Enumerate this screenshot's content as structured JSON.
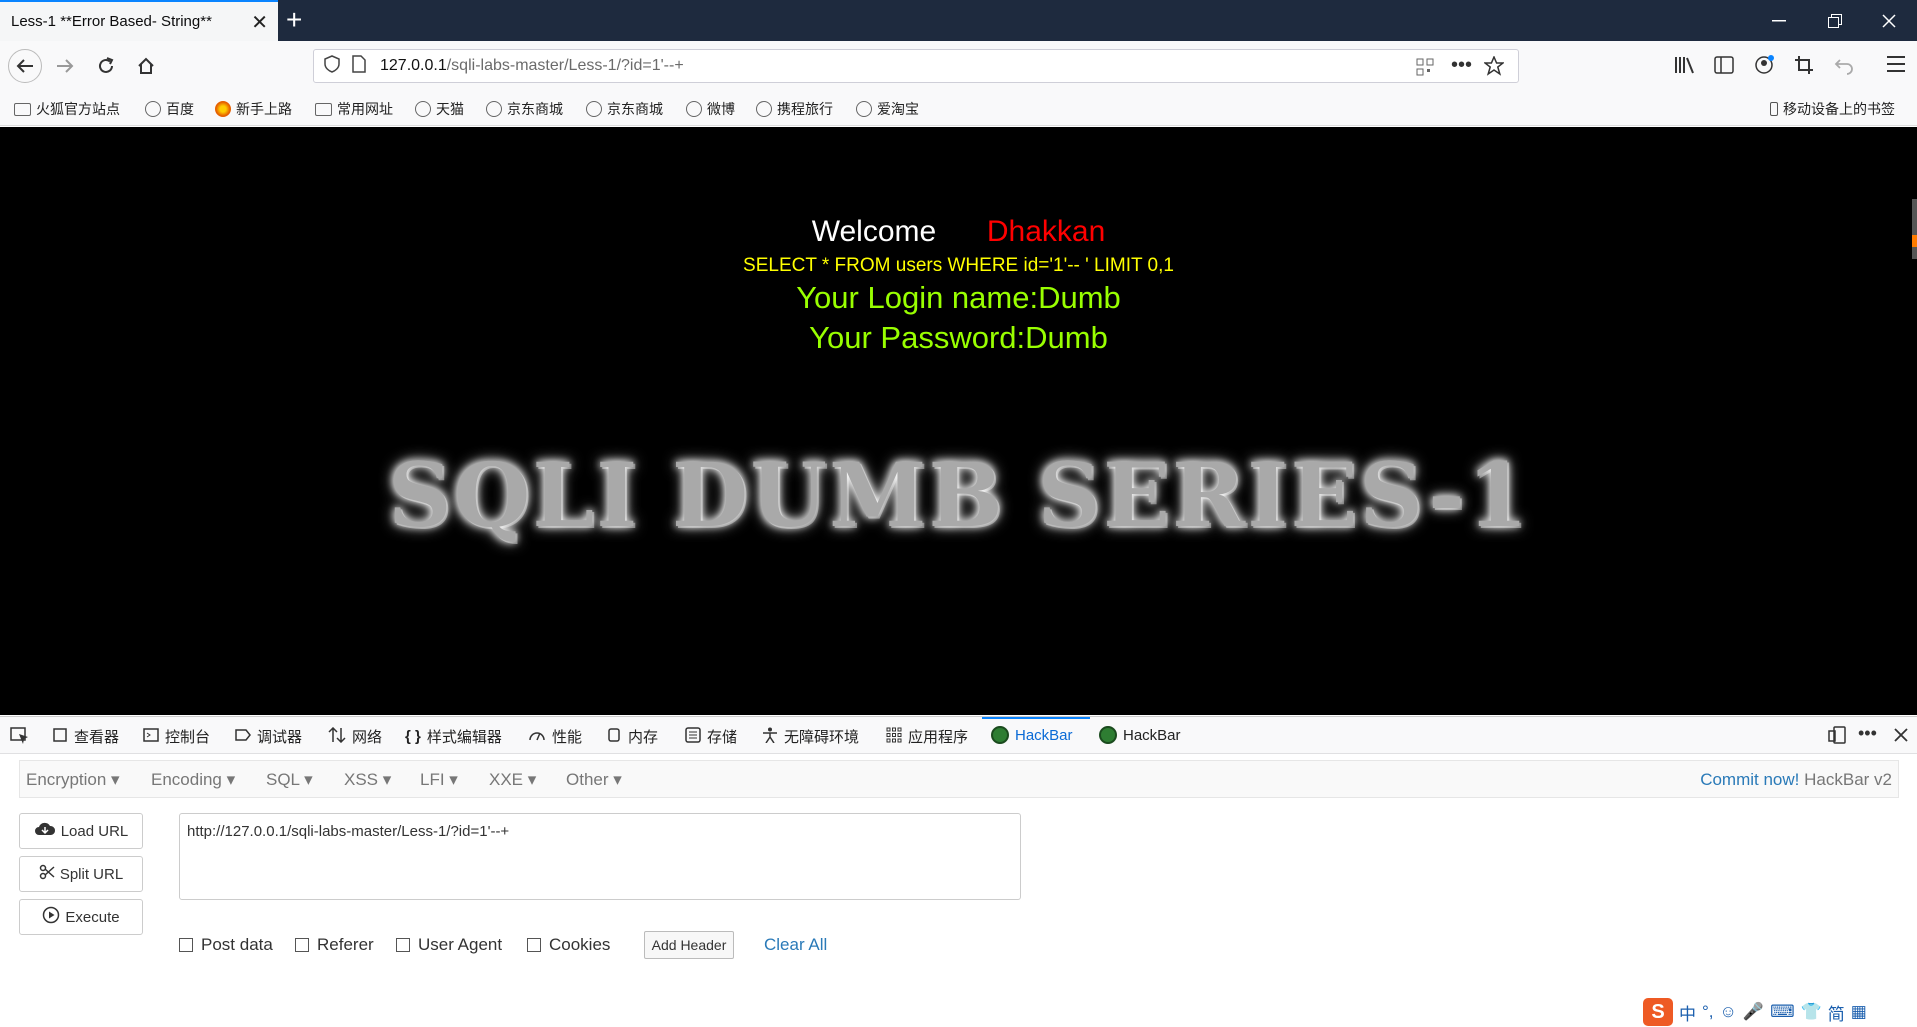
{
  "browser": {
    "tab_title": "Less-1 **Error Based- String**",
    "tab_close": "✕",
    "new_tab": "+",
    "url_host": "127.0.0.1",
    "url_path": "/sqli-labs-master/Less-1/?id=1'--+"
  },
  "bookmarks": [
    {
      "label": "火狐官方站点",
      "icon": "folder-icon"
    },
    {
      "label": "百度",
      "icon": "globe-icon"
    },
    {
      "label": "新手上路",
      "icon": "firefox-icon"
    },
    {
      "label": "常用网址",
      "icon": "folder-icon"
    },
    {
      "label": "天猫",
      "icon": "globe-icon"
    },
    {
      "label": "京东商城",
      "icon": "globe-icon"
    },
    {
      "label": "京东商城",
      "icon": "globe-icon"
    },
    {
      "label": "微博",
      "icon": "globe-icon"
    },
    {
      "label": "携程旅行",
      "icon": "globe-icon"
    },
    {
      "label": "爱淘宝",
      "icon": "globe-icon"
    }
  ],
  "mobile_bookmarks": "移动设备上的书签",
  "page": {
    "welcome": "Welcome",
    "name": "Dhakkan",
    "query": "SELECT * FROM users WHERE id='1'-- ' LIMIT 0,1",
    "login_name": "Your Login name:Dumb",
    "password": "Your Password:Dumb",
    "banner": "SQLI DUMB SERIES-1",
    "colors": {
      "welcome": "#ffffff",
      "name": "#ff0000",
      "query": "#ffff00",
      "login": "#99ff00"
    }
  },
  "devtools": {
    "tabs": [
      {
        "label": "查看器",
        "icon": "inspector-icon"
      },
      {
        "label": "控制台",
        "icon": "console-icon"
      },
      {
        "label": "调试器",
        "icon": "debugger-icon"
      },
      {
        "label": "网络",
        "icon": "network-icon"
      },
      {
        "label": "样式编辑器",
        "icon": "style-editor-icon"
      },
      {
        "label": "性能",
        "icon": "performance-icon"
      },
      {
        "label": "内存",
        "icon": "memory-icon"
      },
      {
        "label": "存储",
        "icon": "storage-icon"
      },
      {
        "label": "无障碍环境",
        "icon": "accessibility-icon"
      },
      {
        "label": "应用程序",
        "icon": "application-icon"
      },
      {
        "label": "HackBar",
        "icon": "hackbar-icon"
      },
      {
        "label": "HackBar",
        "icon": "hackbar-icon"
      }
    ]
  },
  "hackbar": {
    "menu": [
      "Encryption",
      "Encoding",
      "SQL",
      "XSS",
      "LFI",
      "XXE",
      "Other"
    ],
    "commit": "Commit now!",
    "version": "HackBar v2",
    "load_url": "Load URL",
    "split_url": "Split URL",
    "execute": "Execute",
    "url_value": "http://127.0.0.1/sqli-labs-master/Less-1/?id=1'--+",
    "checkboxes": [
      "Post data",
      "Referer",
      "User Agent",
      "Cookies"
    ],
    "add_header": "Add Header",
    "clear_all": "Clear All"
  },
  "ime": {
    "logo": "S",
    "items": [
      "中",
      "°,",
      "☺",
      "🎤",
      "⌨",
      "👕",
      "简",
      "▦"
    ]
  }
}
